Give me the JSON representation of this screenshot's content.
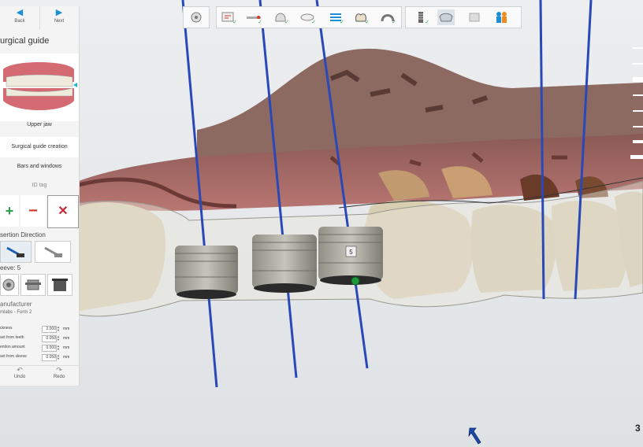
{
  "nav": {
    "back_label": "Back",
    "next_label": "Next"
  },
  "panel": {
    "title": "urgical guide",
    "jaw_label": "Upper jaw",
    "steps": [
      "Surgical guide creation",
      "Bars and windows",
      "ID tag"
    ],
    "insertion_label": "sertion Direction",
    "sleeve_label": "eeve: 5",
    "manufacturer_label": "anufacturer",
    "manufacturer_value": "mlabs - Form 2",
    "params": [
      {
        "label": "ckness",
        "value": "2.000",
        "unit": "mm"
      },
      {
        "label": "set from teeth",
        "value": "0.050",
        "unit": "mm"
      },
      {
        "label": "ention amount",
        "value": "0.000",
        "unit": "mm"
      },
      {
        "label": "set from sleeve",
        "value": "0.050",
        "unit": "mm"
      }
    ],
    "undo_label": "Undo",
    "redo_label": "Redo"
  },
  "viewport": {
    "sleeve_tag": "5",
    "corner_text": "3"
  },
  "colors": {
    "accent": "#1a8fd6",
    "delete": "#d23a2a",
    "add": "#2aa24a"
  },
  "icons": [
    "arrow-left-icon",
    "arrow-right-icon",
    "plus-icon",
    "minus-icon",
    "close-icon",
    "undo-icon",
    "redo-icon"
  ]
}
